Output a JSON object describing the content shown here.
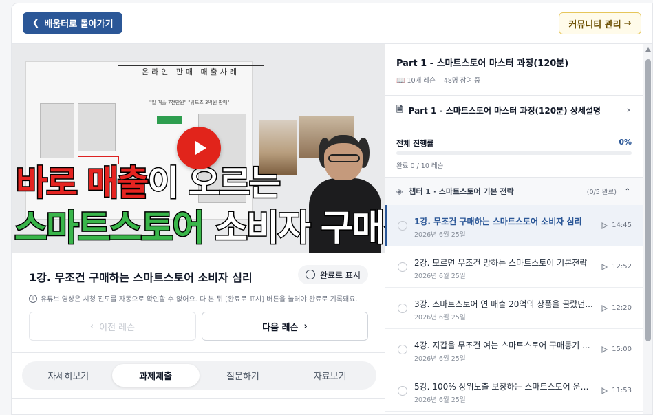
{
  "header": {
    "back_label": "배움터로 돌아가기",
    "community_label": "커뮤니티 관리",
    "community_arrow": "→"
  },
  "video": {
    "slide_title": "온라인 판매 매출사례",
    "slide_subtitle": "\"일 매출 7천만원\" \"위드즈 3억원 판매\"",
    "thumbnail_line1_red": "바로 매출",
    "thumbnail_line1_white": "이 오르는",
    "thumbnail_line2_green": "스마트스토어",
    "thumbnail_line2_white": " 소비자 구매경로"
  },
  "lesson": {
    "title": "1강. 무조건 구매하는 스마트스토어 소비자 심리",
    "complete_label": "완료로 표시",
    "notice": "유튜브 영상은 시청 진도를 자동으로 확인할 수 없어요. 다 본 뒤 [완료로 표시] 버튼을 눌러야 완료로 기록돼요.",
    "prev_label": "이전 레슨",
    "next_label": "다음 레슨"
  },
  "tabs": [
    {
      "label": "자세히보기",
      "active": false
    },
    {
      "label": "과제제출",
      "active": true
    },
    {
      "label": "질문하기",
      "active": false
    },
    {
      "label": "자료보기",
      "active": false
    }
  ],
  "course": {
    "title": "Part 1 - 스마트스토어 마스터 과정(120분)",
    "lesson_count": "10개 레슨",
    "participants": "48명 참여 중",
    "detail_label": "Part 1 - 스마트스토어 마스터 과정(120분) 상세설명",
    "progress_label": "전체 진행률",
    "progress_percent": "0%",
    "progress_value": 0,
    "progress_count": "완료 0 / 10 레슨"
  },
  "chapter": {
    "title": "챕터 1 · 스마트스토어 기본 전략",
    "done": "(0/5 완료)"
  },
  "lessons": [
    {
      "name": "1강. 무조건 구매하는 스마트스토어 소비자 심리",
      "date": "2026년 6월 25일",
      "duration": "14:45",
      "active": true
    },
    {
      "name": "2강. 모르면 무조건 망하는 스마트스토어 기본전략",
      "date": "2026년 6월 25일",
      "duration": "12:52",
      "active": false
    },
    {
      "name": "3강. 스마트스토어 연 매출 20억의 상품을 골랐던...",
      "date": "2026년 6월 25일",
      "duration": "12:20",
      "active": false
    },
    {
      "name": "4강. 지갑을 무조건 여는 스마트스토어 구매동기 ...",
      "date": "2026년 6월 25일",
      "duration": "15:00",
      "active": false
    },
    {
      "name": "5강. 100% 상위노출 보장하는 스마트스토어 운영...",
      "date": "2026년 6월 25일",
      "duration": "11:53",
      "active": false
    }
  ],
  "colors": {
    "primary": "#2b5797",
    "play_red": "#e1241b",
    "community_bg": "#fffbea"
  }
}
